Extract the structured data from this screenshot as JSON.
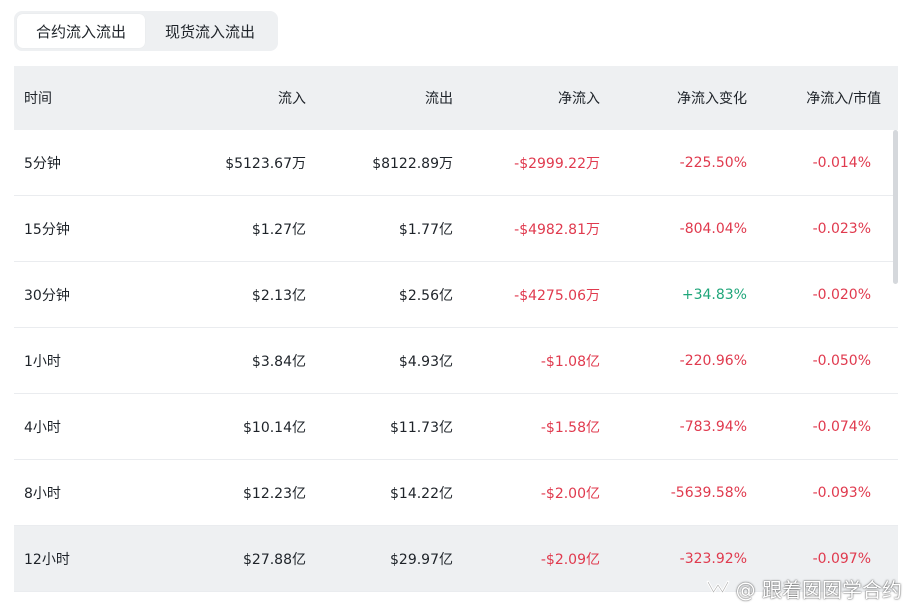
{
  "tabs": [
    {
      "label": "合约流入流出",
      "active": true
    },
    {
      "label": "现货流入流出",
      "active": false
    }
  ],
  "table": {
    "headers": [
      "时间",
      "流入",
      "流出",
      "净流入",
      "净流入变化",
      "净流入/市值"
    ],
    "rows": [
      {
        "time": "5分钟",
        "inflow": "$5123.67万",
        "outflow": "$8122.89万",
        "net": "-$2999.22万",
        "change": "-225.50%",
        "ratio": "-0.014%"
      },
      {
        "time": "15分钟",
        "inflow": "$1.27亿",
        "outflow": "$1.77亿",
        "net": "-$4982.81万",
        "change": "-804.04%",
        "ratio": "-0.023%"
      },
      {
        "time": "30分钟",
        "inflow": "$2.13亿",
        "outflow": "$2.56亿",
        "net": "-$4275.06万",
        "change": "+34.83%",
        "ratio": "-0.020%"
      },
      {
        "time": "1小时",
        "inflow": "$3.84亿",
        "outflow": "$4.93亿",
        "net": "-$1.08亿",
        "change": "-220.96%",
        "ratio": "-0.050%"
      },
      {
        "time": "4小时",
        "inflow": "$10.14亿",
        "outflow": "$11.73亿",
        "net": "-$1.58亿",
        "change": "-783.94%",
        "ratio": "-0.074%"
      },
      {
        "time": "8小时",
        "inflow": "$12.23亿",
        "outflow": "$14.22亿",
        "net": "-$2.00亿",
        "change": "-5639.58%",
        "ratio": "-0.093%"
      },
      {
        "time": "12小时",
        "inflow": "$27.88亿",
        "outflow": "$29.97亿",
        "net": "-$2.09亿",
        "change": "-323.92%",
        "ratio": "-0.097%"
      }
    ]
  },
  "colors": {
    "negative": "#e03a4e",
    "positive": "#20a67a",
    "header_bg": "#eef0f2"
  },
  "watermark": {
    "text": "@ 跟着囡囡学合约",
    "icon": "wechat-channels-logo"
  }
}
